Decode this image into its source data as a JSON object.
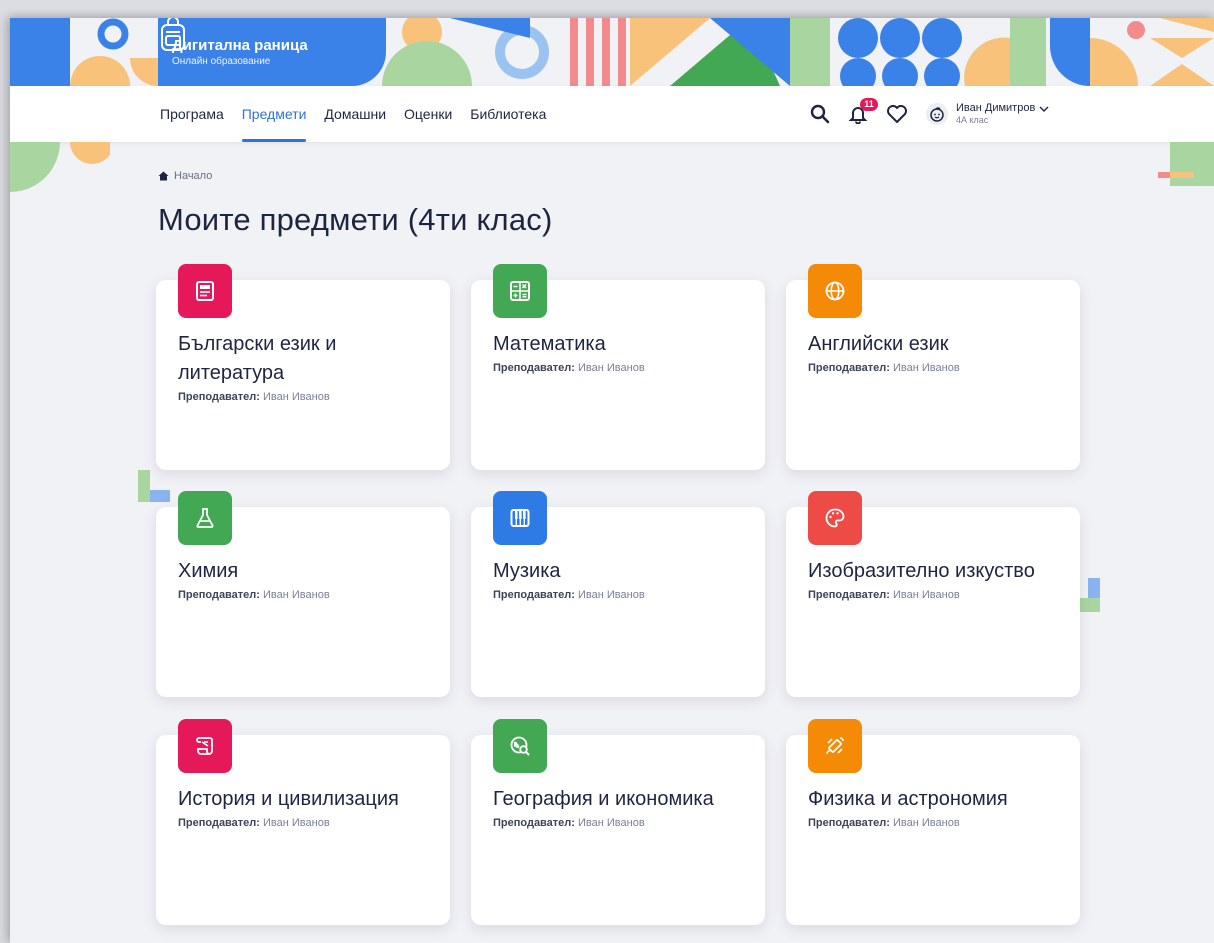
{
  "app": {
    "name": "Дигитална раница",
    "tagline": "Онлайн образование"
  },
  "nav": {
    "items": [
      {
        "label": "Програма",
        "active": false
      },
      {
        "label": "Предмети",
        "active": true
      },
      {
        "label": "Домашни",
        "active": false
      },
      {
        "label": "Оценки",
        "active": false
      },
      {
        "label": "Библиотека",
        "active": false
      }
    ],
    "notifications_count": "11",
    "icons": [
      "search-icon",
      "bell-icon",
      "heart-icon"
    ]
  },
  "user": {
    "name": "Иван Димитров",
    "class": "4А клас"
  },
  "breadcrumb": {
    "home": "Начало"
  },
  "page": {
    "title": "Моите предмети (4ти клас)"
  },
  "teacher_label": "Преподавател:",
  "subjects": [
    {
      "title": "Български език и литература",
      "teacher": "Иван Иванов",
      "icon": "newspaper-icon",
      "color": "#e5195a"
    },
    {
      "title": "Математика",
      "teacher": "Иван Иванов",
      "icon": "calculator-icon",
      "color": "#43a853"
    },
    {
      "title": "Английски език",
      "teacher": "Иван Иванов",
      "icon": "globe-icon",
      "color": "#f58a07"
    },
    {
      "title": "Химия",
      "teacher": "Иван Иванов",
      "icon": "flask-icon",
      "color": "#43a853"
    },
    {
      "title": "Музика",
      "teacher": "Иван Иванов",
      "icon": "piano-icon",
      "color": "#2e7be6"
    },
    {
      "title": "Изобразително изкуство",
      "teacher": "Иван Иванов",
      "icon": "palette-icon",
      "color": "#ee4a46"
    },
    {
      "title": "История и цивилизация",
      "teacher": "Иван Иванов",
      "icon": "scroll-icon",
      "color": "#e5195a"
    },
    {
      "title": "География и икономика",
      "teacher": "Иван Иванов",
      "icon": "globe-search-icon",
      "color": "#43a853"
    },
    {
      "title": "Физика и астрономия",
      "teacher": "Иван Иванов",
      "icon": "satellite-icon",
      "color": "#f58a07"
    }
  ]
}
